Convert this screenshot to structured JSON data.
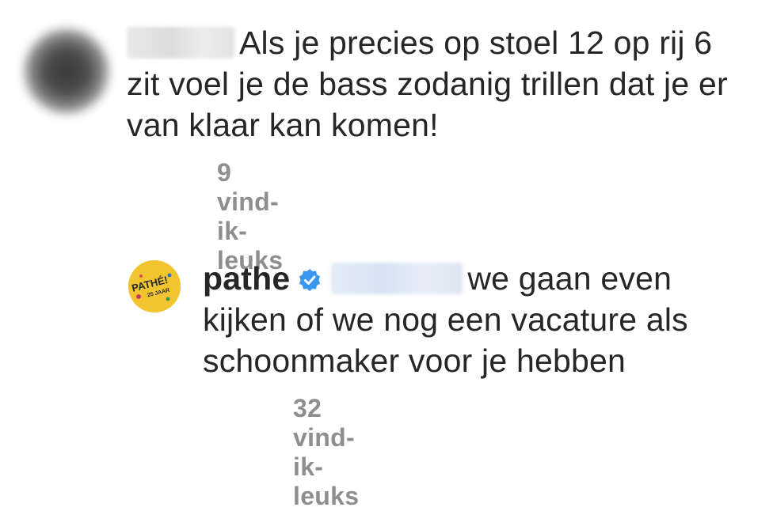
{
  "comments": [
    {
      "username_hidden": true,
      "text": "Als je precies op stoel 12 op rij 6 zit voel je de bass zodanig trillen dat je er van klaar kan komen!",
      "likes": "9 vind-ik-leuks"
    },
    {
      "username": "pathe",
      "verified": true,
      "mention_hidden": true,
      "text": "we gaan even kijken of we nog een vacature als schoonmaker voor je hebben",
      "likes": "32 vind-ik-leuks"
    }
  ],
  "colors": {
    "text": "#262626",
    "secondary": "#8e8e8e",
    "verified": "#3897f0",
    "pathe_yellow": "#f2c530"
  },
  "avatar_logo": {
    "line1": "PATHÉ!",
    "line2": "25 JAAR"
  }
}
